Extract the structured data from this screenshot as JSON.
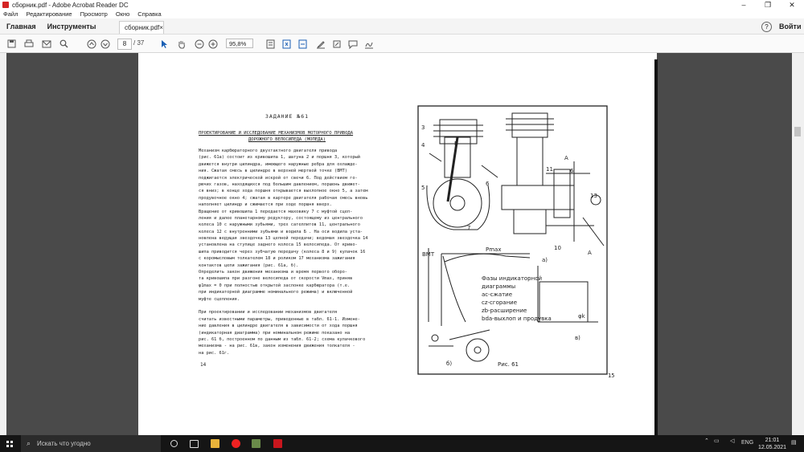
{
  "window": {
    "title": "сборник.pdf - Adobe Acrobat Reader DC",
    "minimize": "–",
    "maximize": "❐",
    "close": "✕"
  },
  "menu": [
    "Файл",
    "Редактирование",
    "Просмотр",
    "Окно",
    "Справка"
  ],
  "nav": {
    "home": "Главная",
    "tools": "Инструменты",
    "doc_tab": "сборник.pdf",
    "doc_close": "×",
    "help": "?",
    "login": "Войти"
  },
  "toolbar": {
    "page_current": "8",
    "page_total": "/ 37",
    "zoom": "95,8%"
  },
  "icons": [
    "save-icon",
    "print-icon",
    "email-icon",
    "search-icon",
    "page-up-icon",
    "page-down-icon",
    "select-cursor-icon",
    "hand-icon",
    "zoom-out-icon",
    "zoom-in-icon",
    "scroll-mode-icon",
    "fit-page-icon",
    "rotate-icon",
    "highlight-icon",
    "comment-icon",
    "sign-icon",
    "markup-icon"
  ],
  "document": {
    "heading": "ЗАДАНИЕ №61",
    "subtitle_line1": "ПРОЕКТИРОВАНИЕ И ИССЛЕДОВАНИЕ МЕХАНИЗМОВ МОТОРНОГО ПРИВОДА",
    "subtitle_line2": "ДОРОЖНОГО ВЕЛОСИПЕДА (МОПЕДА)",
    "body": [
      "   Механизм карбюраторного двухтактного двигателя привода",
      "(рис. 61а) состоит из кривошипа 1, шатуна 2 и поршня 3, который",
      "движется внутри цилиндра, имеющего наружные ребра для охлажде-",
      "ния. Сжатая смесь в цилиндре в верхней мертвой точке (ВМТ)",
      "поджигается электрической искрой от свечи 6. Под действием го-",
      "рючих газов, находящихся под большим давлением, поршень движет-",
      "ся вниз; в конце хода поршня открывается выхлопное окно 5, а затем",
      "продувочное окно 4; сжатая в картере двигателя рабочая смесь вновь",
      "наполняет  цилиндр и сжимается при ходе поршня вверх.",
      "   Вращение от кривошипа 1 передается маховику 7 с муфтой сцеп-",
      "ления и далее планетарному редуктору, состоящему из центрального",
      "колеса 10 с наружными зубьями, трех сателлитов 11, центрального",
      "колеса 12 с внутренними зубьями и водила Б . На оси водила уста-",
      "новлена ведущая звездочка 13 цепной передачи; ведомая звездочка 14",
      "установлена на ступице заднего колеса 15 велосипеда. От криво-",
      "шипа приводится через зубчатую передачу (колеса 8 и 9) кулачок 16",
      "с коромысловым толкателем 18 и роликом 17 механизма зажигания",
      "контактов цепи зажигания (рис. 61а, б).",
      "   Определить закон движения механизма и время первого оборо-",
      "та кривошипа при разгоне велосипеда от скорости Vmax, приняв",
      "φ1max = 0 при полностью открытой заслонке карбюратора (т.е.",
      "при индикаторной диаграмме номинального режима) и включенной",
      "муфте сцепления.",
      "",
      "   При проектировании и исследовании механизмов двигателя",
      "считать известными параметры, приведенные в табл. 61-1. Измене-",
      "ние давления в цилиндре двигателя в зависимости от хода поршня",
      "(индикаторная диаграмма) при номинальном режиме показано на",
      "рис. 61 б, построенном по данным из табл. 61-2; схема кулачкового",
      "механизма - на рис. 61в, закон изменения движения толкателя -",
      "на рис. 61г."
    ],
    "page_left": "14",
    "page_right": "15",
    "figure_caption": "Рис. 61"
  },
  "taskbar": {
    "search_placeholder": "Искать что угодно",
    "language": "ENG",
    "time": "21:01",
    "date": "12.05.2021"
  }
}
